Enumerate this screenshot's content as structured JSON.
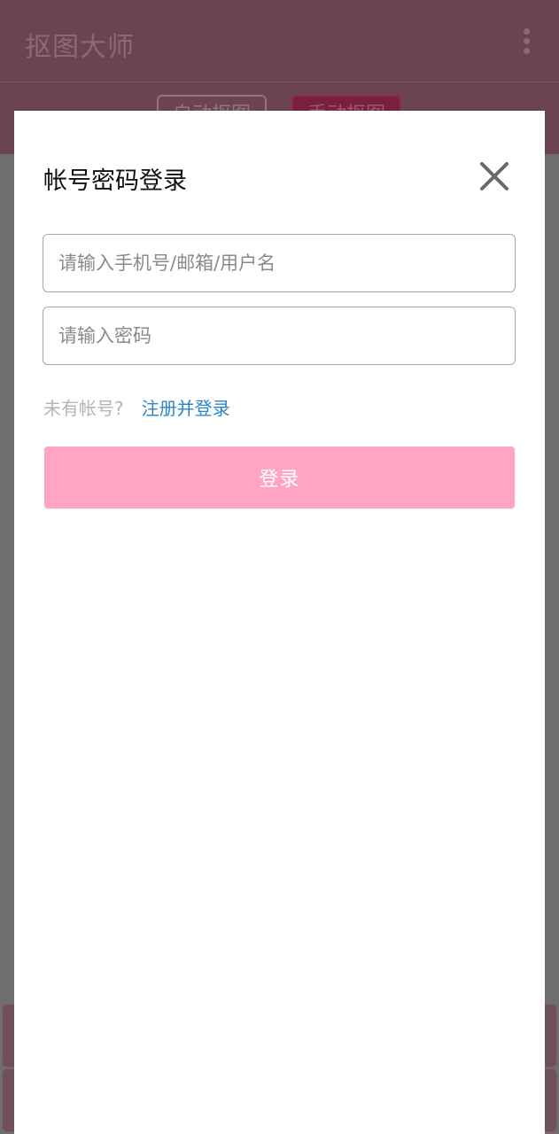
{
  "app": {
    "title": "抠图大师",
    "menu_icon": "more-vertical-icon"
  },
  "tabs": [
    {
      "label": "自动抠图",
      "active": false
    },
    {
      "label": "手动抠图",
      "active": true
    }
  ],
  "dialog": {
    "title": "帐号密码登录",
    "close_icon": "close-icon",
    "account_placeholder": "请输入手机号/邮箱/用户名",
    "account_value": "",
    "password_placeholder": "请输入密码",
    "password_value": "",
    "no_account_text": "未有帐号?",
    "register_link": "注册并登录",
    "login_button": "登录"
  },
  "colors": {
    "accent": "#ffa5c3",
    "link": "#2a86c9",
    "appbar_dimmed": "#6b4450"
  }
}
